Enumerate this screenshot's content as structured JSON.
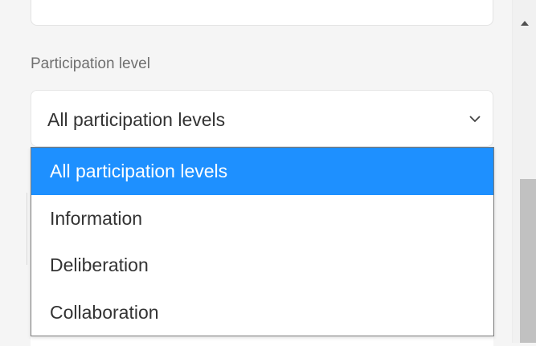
{
  "form": {
    "field_label": "Participation level",
    "select": {
      "selected_value": "All participation levels",
      "icon": "chevron-down-icon"
    },
    "dropdown": {
      "options": [
        {
          "label": "All participation levels",
          "selected": true
        },
        {
          "label": "Information",
          "selected": false
        },
        {
          "label": "Deliberation",
          "selected": false
        },
        {
          "label": "Collaboration",
          "selected": false
        }
      ]
    }
  },
  "colors": {
    "highlight": "#1e90ff",
    "text": "#333333",
    "label": "#6f6f6f",
    "background": "#f5f5f5"
  },
  "scrollbar": {
    "up_icon": "scroll-up-arrow-icon"
  }
}
